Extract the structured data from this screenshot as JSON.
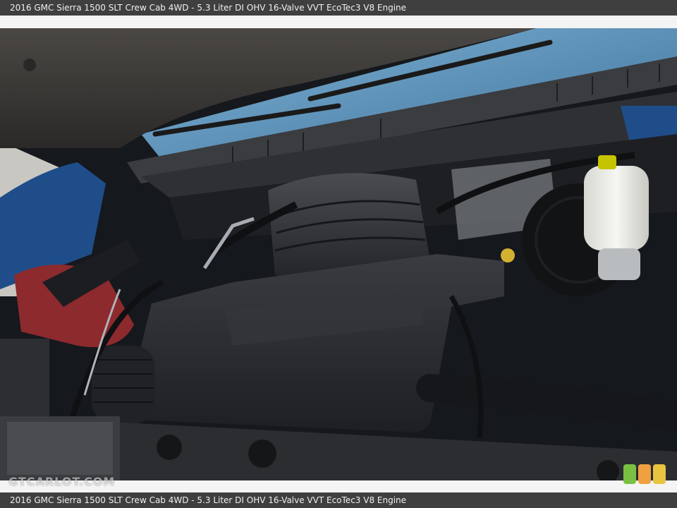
{
  "caption": {
    "top_text": "2016 GMC Sierra 1500 SLT Crew Cab 4WD - 5.3 Liter DI OHV 16-Valve VVT EcoTec3 V8 Engine",
    "bottom_text": "2016 GMC Sierra 1500 SLT Crew Cab 4WD - 5.3 Liter DI OHV 16-Valve VVT EcoTec3 V8 Engine"
  },
  "watermark": {
    "text": "GTCARLOT.COM"
  },
  "badges": [
    {
      "name": "green",
      "color": "#7ac143"
    },
    {
      "name": "orange",
      "color": "#f0a040"
    },
    {
      "name": "yellow",
      "color": "#e8c440"
    }
  ],
  "colors": {
    "hood": "#3a3835",
    "body_blue": "#1f4d8a",
    "engine_cover": "#2a2c30",
    "coolant_reservoir": "#ecece6",
    "windshield": "#5a90b8"
  }
}
